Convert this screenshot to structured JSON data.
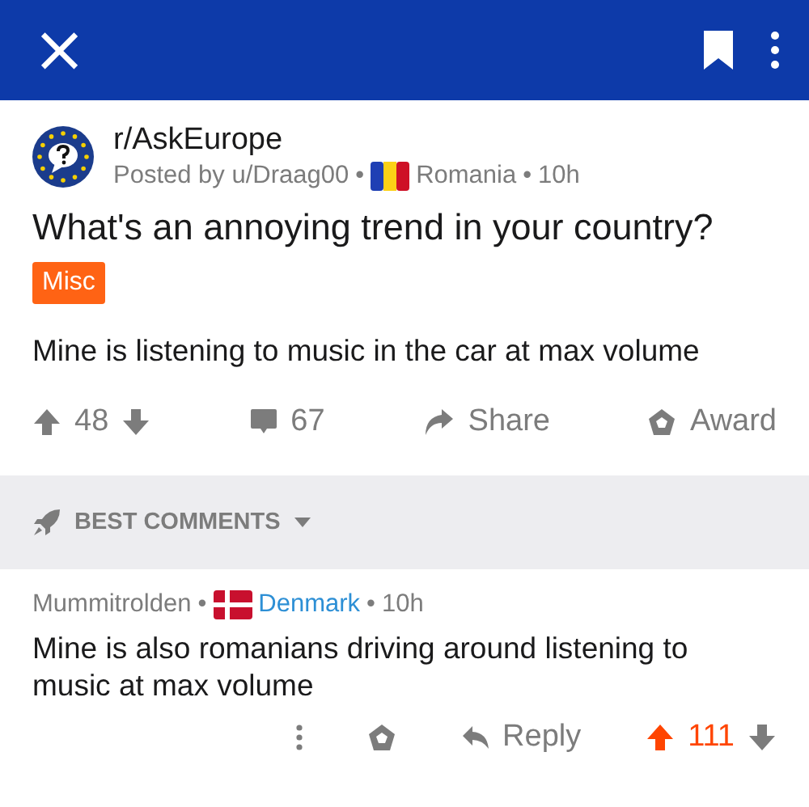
{
  "header": {
    "close": "×",
    "bookmarked": true
  },
  "post": {
    "subreddit": "r/AskEurope",
    "author": "Posted by u/Draag00",
    "author_sep": "•",
    "flair_country": "Romania",
    "flag": {
      "kind": "romania"
    },
    "time_sep": "•",
    "time": "10h",
    "title": "What's an annoying trend in your country?",
    "tag": "Misc",
    "body": "Mine is listening to music in the car at max volume",
    "actions": {
      "score": "48",
      "upvoted": false,
      "comments": "67",
      "share": "Share",
      "award": "Award"
    }
  },
  "sort": {
    "label": "BEST COMMENTS"
  },
  "comment": {
    "author": "Mummitrolden",
    "sep": "•",
    "flag": {
      "kind": "denmark"
    },
    "flair_country": "Denmark",
    "time_sep": "•",
    "time": "10h",
    "body": "Mine is also romanians driving around listening to music at max volume",
    "actions": {
      "reply": "Reply",
      "score": "111",
      "upvoted": true
    }
  }
}
